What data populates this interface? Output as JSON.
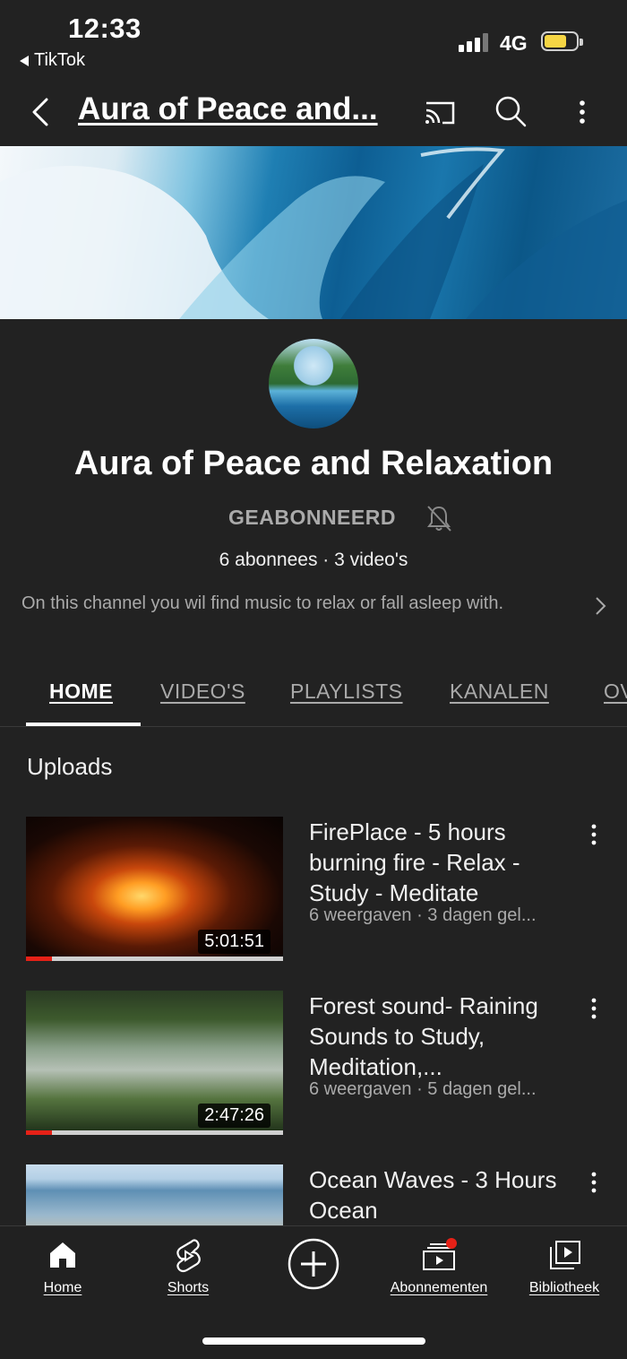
{
  "status_bar": {
    "time": "12:33",
    "back_app": "TikTok",
    "network": "4G"
  },
  "app_bar": {
    "title": "Aura of Peace and..."
  },
  "channel": {
    "name": "Aura of Peace and Relaxation",
    "subscribe_label": "GEABONNEERD",
    "stats": "6 abonnees · 3 video's",
    "description": "On this channel you wil find music to relax or fall asleep with."
  },
  "tabs": [
    {
      "label": "HOME"
    },
    {
      "label": "VIDEO'S"
    },
    {
      "label": "PLAYLISTS"
    },
    {
      "label": "KANALEN"
    },
    {
      "label": "OV"
    }
  ],
  "section_title": "Uploads",
  "videos": [
    {
      "title": "FirePlace - 5 hours burning fire - Relax - Study - Meditate",
      "meta": "6 weergaven · 3 dagen gel...",
      "duration": "5:01:51",
      "progress": 0.1
    },
    {
      "title": "Forest sound- Raining Sounds to Study, Meditation,...",
      "meta": "6 weergaven · 5 dagen gel...",
      "duration": "2:47:26",
      "progress": 0.1
    },
    {
      "title": "Ocean Waves - 3 Hours Ocean",
      "meta": "",
      "duration": ""
    }
  ],
  "bottom_nav": [
    {
      "label": "Home",
      "icon": "home-icon"
    },
    {
      "label": "Shorts",
      "icon": "shorts-icon"
    },
    {
      "label": "",
      "icon": "create-plus-icon"
    },
    {
      "label": "Abonnementen",
      "icon": "subscriptions-icon"
    },
    {
      "label": "Bibliotheek",
      "icon": "library-icon"
    }
  ],
  "colors": {
    "background": "#222222",
    "progress_watched": "#e62117",
    "battery": "#f5d544",
    "notification_dot": "#e62117"
  }
}
